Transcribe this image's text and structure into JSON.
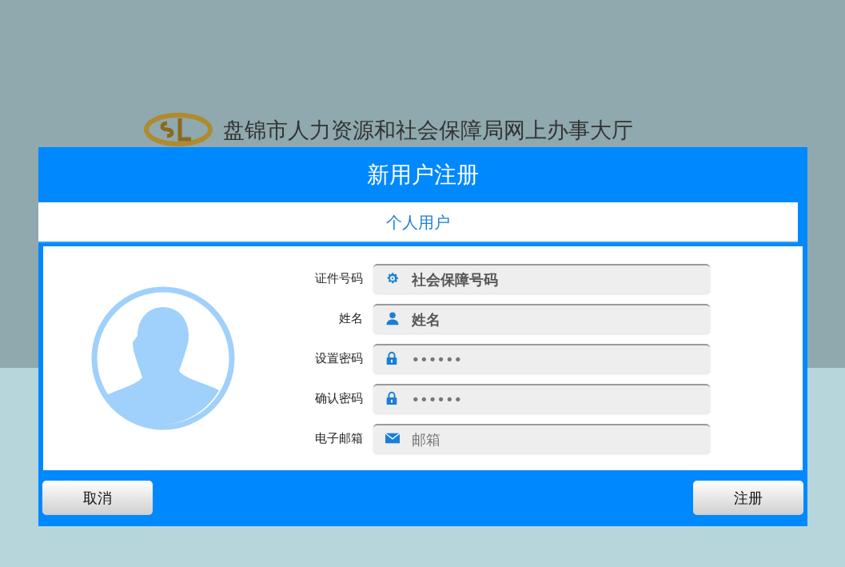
{
  "header": {
    "title": "盘锦市人力资源和社会保障局网上办事大厅"
  },
  "dialog": {
    "title": "新用户注册",
    "tabs": [
      {
        "label": "个人用户",
        "selected": true
      }
    ]
  },
  "fields": [
    {
      "label": "证件号码",
      "kind": "id",
      "placeholder": "社会保障号码",
      "emphasis": true
    },
    {
      "label": "姓名",
      "kind": "person",
      "placeholder": "姓名",
      "emphasis": true
    },
    {
      "label": "设置密码",
      "kind": "password",
      "placeholder": "••••••",
      "emphasis": false
    },
    {
      "label": "确认密码",
      "kind": "password",
      "placeholder": "••••••",
      "emphasis": false
    },
    {
      "label": "电子邮箱",
      "kind": "email",
      "placeholder": "邮箱",
      "emphasis": false
    }
  ],
  "buttons": [
    {
      "label": "取消"
    },
    {
      "label": "注册"
    }
  ]
}
